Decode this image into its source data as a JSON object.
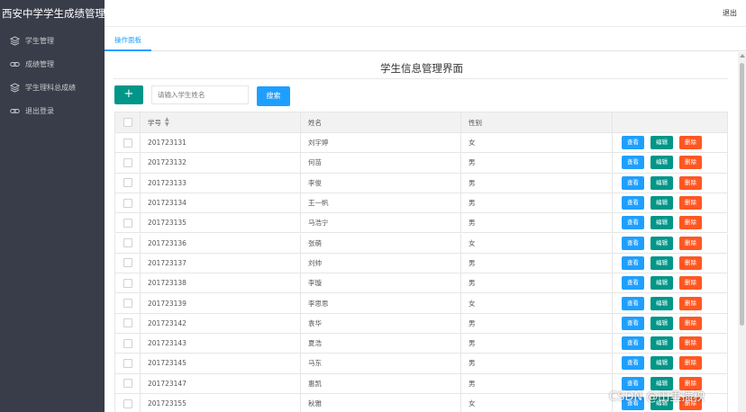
{
  "app": {
    "title": "西安中学学生成绩管理系",
    "logout_label": "退出"
  },
  "sidebar": {
    "items": [
      {
        "label": "学生管理",
        "icon": "layers-icon"
      },
      {
        "label": "成绩管理",
        "icon": "link-icon"
      },
      {
        "label": "学生理科总成绩",
        "icon": "layers-icon"
      },
      {
        "label": "退出登录",
        "icon": "link-icon"
      }
    ]
  },
  "tabs": [
    {
      "label": "操作面板",
      "active": true
    }
  ],
  "main": {
    "title": "学生信息管理界面",
    "add_label": "+",
    "search": {
      "placeholder": "请输入学生姓名",
      "value": "",
      "button_label": "搜索"
    }
  },
  "table": {
    "columns": [
      "学号",
      "姓名",
      "性别"
    ],
    "actions": {
      "view": "查看",
      "edit": "编辑",
      "delete": "删除"
    },
    "rows": [
      {
        "id": "201723131",
        "name": "刘宇婷",
        "sex": "女"
      },
      {
        "id": "201723132",
        "name": "何苗",
        "sex": "男"
      },
      {
        "id": "201723133",
        "name": "李俊",
        "sex": "男"
      },
      {
        "id": "201723134",
        "name": "王一帆",
        "sex": "男"
      },
      {
        "id": "201723135",
        "name": "马浩宁",
        "sex": "男"
      },
      {
        "id": "201723136",
        "name": "张萌",
        "sex": "女"
      },
      {
        "id": "201723137",
        "name": "刘帅",
        "sex": "男"
      },
      {
        "id": "201723138",
        "name": "李璇",
        "sex": "男"
      },
      {
        "id": "201723139",
        "name": "李思思",
        "sex": "女"
      },
      {
        "id": "201723142",
        "name": "袁华",
        "sex": "男"
      },
      {
        "id": "201723143",
        "name": "夏浩",
        "sex": "男"
      },
      {
        "id": "201723145",
        "name": "马东",
        "sex": "男"
      },
      {
        "id": "201723147",
        "name": "惠凯",
        "sex": "男"
      },
      {
        "id": "201723155",
        "name": "秋雅",
        "sex": "女"
      }
    ]
  },
  "colors": {
    "sidebar_bg": "#393d49",
    "accent_blue": "#1e9fff",
    "accent_green": "#009688",
    "accent_red": "#ff5722"
  },
  "watermark": "CSDN @田里插秧"
}
